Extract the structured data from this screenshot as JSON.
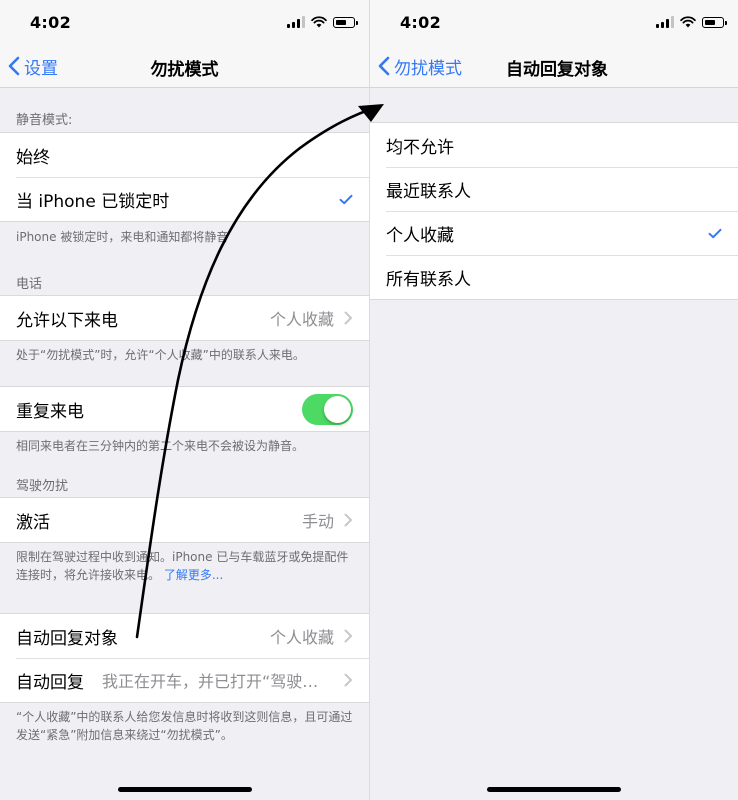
{
  "status_bar": {
    "time": "4:02"
  },
  "left": {
    "nav": {
      "back_label": "设置",
      "title": "勿扰模式"
    },
    "silence": {
      "header": "静音模式:",
      "always": "始终",
      "locked": "当 iPhone 已锁定时",
      "footer": "iPhone 被锁定时，来电和通知都将静音"
    },
    "phone": {
      "header": "电话",
      "allow_calls_label": "允许以下来电",
      "allow_calls_value": "个人收藏",
      "footer": "处于“勿扰模式”时，允许“个人收藏”中的联系人来电。"
    },
    "repeated": {
      "label": "重复来电",
      "enabled": true,
      "footer": "相同来电者在三分钟内的第二个来电不会被设为静音。"
    },
    "driving": {
      "header": "驾驶勿扰",
      "activate_label": "激活",
      "activate_value": "手动",
      "footer_text": "限制在驾驶过程中收到通知。iPhone 已与车载蓝牙或免提配件连接时，将允许接收来电。",
      "footer_link": "了解更多..."
    },
    "auto_reply": {
      "to_label": "自动回复对象",
      "to_value": "个人收藏",
      "reply_label": "自动回复",
      "reply_value": "我正在开车，并已打开“驾驶勿扰”",
      "footer": "“个人收藏”中的联系人给您发信息时将收到这则信息，且可通过发送“紧急”附加信息来绕过“勿扰模式”。"
    }
  },
  "right": {
    "nav": {
      "back_label": "勿扰模式",
      "title": "自动回复对象"
    },
    "options": [
      {
        "label": "均不允许",
        "selected": false
      },
      {
        "label": "最近联系人",
        "selected": false
      },
      {
        "label": "个人收藏",
        "selected": true
      },
      {
        "label": "所有联系人",
        "selected": false
      }
    ]
  },
  "colors": {
    "accent": "#3478f6",
    "toggle_on": "#4cd964",
    "background": "#efeff4"
  },
  "icons": [
    "chevron-left-icon",
    "chevron-right-icon",
    "checkmark-icon",
    "signal-icon",
    "wifi-icon",
    "battery-icon",
    "arrow-annotation"
  ]
}
